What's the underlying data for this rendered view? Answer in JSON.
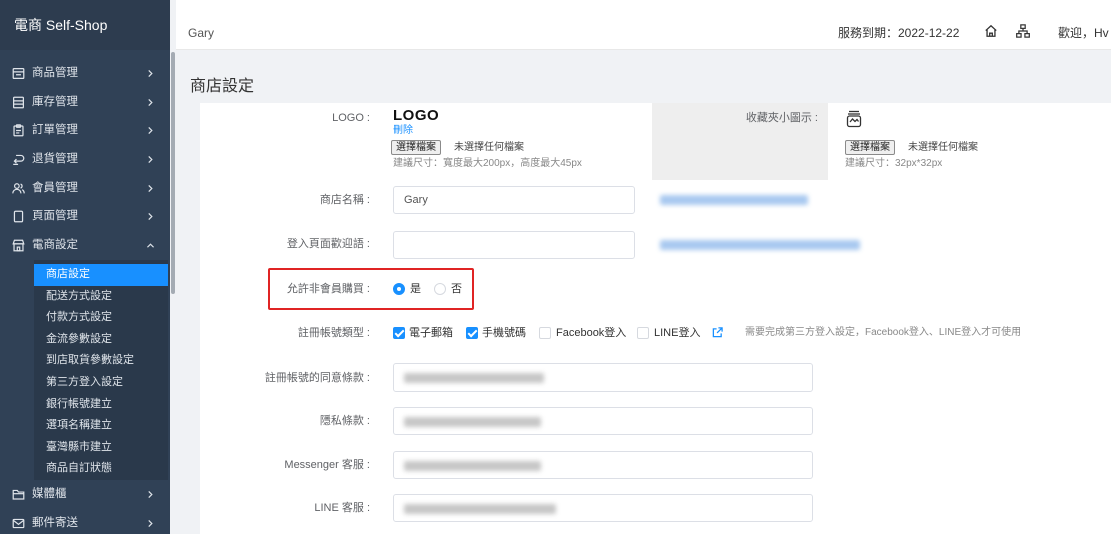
{
  "app": {
    "title": "電商 Self-Shop"
  },
  "sidebar": {
    "items": [
      {
        "label": "商品管理",
        "icon": "store-icon"
      },
      {
        "label": "庫存管理",
        "icon": "list-icon"
      },
      {
        "label": "訂單管理",
        "icon": "clipboard-icon"
      },
      {
        "label": "退貨管理",
        "icon": "return-icon"
      },
      {
        "label": "會員管理",
        "icon": "members-icon"
      },
      {
        "label": "頁面管理",
        "icon": "page-icon"
      },
      {
        "label": "電商設定",
        "icon": "shop-icon",
        "expanded": true
      },
      {
        "label": "媒體櫃",
        "icon": "folder-icon"
      },
      {
        "label": "郵件寄送",
        "icon": "mail-icon"
      }
    ],
    "submenu": [
      {
        "label": "商店設定",
        "active": true
      },
      {
        "label": "配送方式設定"
      },
      {
        "label": "付款方式設定"
      },
      {
        "label": "金流參數設定"
      },
      {
        "label": "到店取貨參數設定"
      },
      {
        "label": "第三方登入設定"
      },
      {
        "label": "銀行帳號建立"
      },
      {
        "label": "選項名稱建立"
      },
      {
        "label": "臺灣縣市建立"
      },
      {
        "label": "商品自訂狀態"
      }
    ]
  },
  "header": {
    "user": "Gary",
    "service_expiry": "服務到期：2022-12-22",
    "icons": [
      "home-icon",
      "sitemap-icon"
    ],
    "welcome": "歡迎，Hv"
  },
  "page": {
    "title": "商店設定"
  },
  "form": {
    "logo": {
      "label": "LOGO :",
      "preview_text": "LOGO",
      "delete_link": "刪除",
      "file_button": "選擇檔案",
      "file_status": "未選擇任何檔案",
      "hint": "建議尺寸：寬度最大200px，高度最大45px"
    },
    "favicon": {
      "label": "收藏夾小圖示 :",
      "icon": "favicon-preview-icon",
      "file_button": "選擇檔案",
      "file_status": "未選擇任何檔案",
      "hint": "建議尺寸：32px*32px"
    },
    "store_name": {
      "label": "商店名稱 :",
      "value": "Gary"
    },
    "login_welcome": {
      "label": "登入頁面歡迎語 :",
      "value": ""
    },
    "allow_guest_purchase": {
      "label": "允許非會員購買 :",
      "options": [
        {
          "label": "是",
          "checked": true
        },
        {
          "label": "否",
          "checked": false
        }
      ]
    },
    "register_types": {
      "label": "註冊帳號類型 :",
      "options": [
        {
          "label": "電子郵箱",
          "checked": true
        },
        {
          "label": "手機號碼",
          "checked": true
        },
        {
          "label": "Facebook登入",
          "checked": false
        },
        {
          "label": "LINE登入",
          "checked": false
        }
      ],
      "link_icon": "external-link-icon",
      "note": "需要完成第三方登入設定，Facebook登入、LINE登入才可使用"
    },
    "register_terms": {
      "label": "註冊帳號的同意條款 :"
    },
    "privacy_terms": {
      "label": "隱私條款 :"
    },
    "messenger_service": {
      "label": "Messenger 客服 :"
    },
    "line_service": {
      "label": "LINE 客服 :"
    }
  },
  "colors": {
    "sidebar_bg": "#304156",
    "accent": "#1890ff",
    "highlight_border": "#e02424"
  }
}
